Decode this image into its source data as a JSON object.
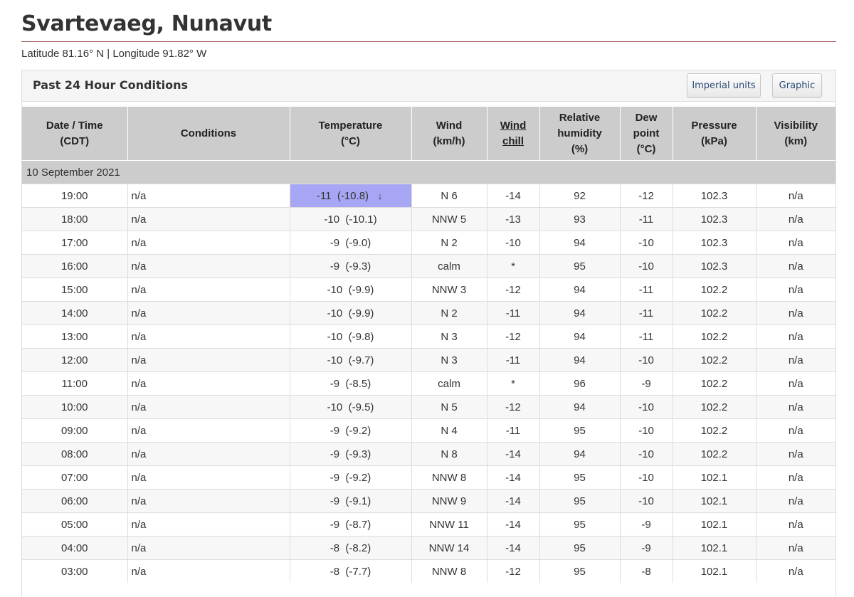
{
  "header": {
    "title": "Svartevaeg, Nunavut",
    "coordinates": "Latitude 81.16° N | Longitude 91.82° W"
  },
  "panel": {
    "title": "Past 24 Hour Conditions",
    "imperial_button": "Imperial units",
    "graphic_button": "Graphic"
  },
  "columns": {
    "datetime": [
      "Date / Time",
      "(CDT)"
    ],
    "conditions": "Conditions",
    "temperature": [
      "Temperature",
      "(°C)"
    ],
    "wind": [
      "Wind",
      "(km/h)"
    ],
    "wind_chill": [
      "Wind",
      "chill"
    ],
    "humidity": [
      "Relative",
      "humidity",
      "(%)"
    ],
    "dew_point": [
      "Dew",
      "point",
      "(°C)"
    ],
    "pressure": [
      "Pressure",
      "(kPa)"
    ],
    "visibility": [
      "Visibility",
      "(km)"
    ]
  },
  "date_group": "10 September 2021",
  "rows": [
    {
      "time": "19:00",
      "conditions": "n/a",
      "temp": "-11  (-10.8)",
      "wind": "N 6",
      "wind_chill": "-14",
      "humidity": "92",
      "dew_point": "-12",
      "pressure": "102.3",
      "visibility": "n/a",
      "temp_trend": "down-arrow-icon"
    },
    {
      "time": "18:00",
      "conditions": "n/a",
      "temp": "-10  (-10.1)",
      "wind": "NNW 5",
      "wind_chill": "-13",
      "humidity": "93",
      "dew_point": "-11",
      "pressure": "102.3",
      "visibility": "n/a"
    },
    {
      "time": "17:00",
      "conditions": "n/a",
      "temp": "-9  (-9.0)",
      "wind": "N 2",
      "wind_chill": "-10",
      "humidity": "94",
      "dew_point": "-10",
      "pressure": "102.3",
      "visibility": "n/a"
    },
    {
      "time": "16:00",
      "conditions": "n/a",
      "temp": "-9  (-9.3)",
      "wind": "calm",
      "wind_chill": "*",
      "humidity": "95",
      "dew_point": "-10",
      "pressure": "102.3",
      "visibility": "n/a"
    },
    {
      "time": "15:00",
      "conditions": "n/a",
      "temp": "-10  (-9.9)",
      "wind": "NNW 3",
      "wind_chill": "-12",
      "humidity": "94",
      "dew_point": "-11",
      "pressure": "102.2",
      "visibility": "n/a"
    },
    {
      "time": "14:00",
      "conditions": "n/a",
      "temp": "-10  (-9.9)",
      "wind": "N 2",
      "wind_chill": "-11",
      "humidity": "94",
      "dew_point": "-11",
      "pressure": "102.2",
      "visibility": "n/a"
    },
    {
      "time": "13:00",
      "conditions": "n/a",
      "temp": "-10  (-9.8)",
      "wind": "N 3",
      "wind_chill": "-12",
      "humidity": "94",
      "dew_point": "-11",
      "pressure": "102.2",
      "visibility": "n/a"
    },
    {
      "time": "12:00",
      "conditions": "n/a",
      "temp": "-10  (-9.7)",
      "wind": "N 3",
      "wind_chill": "-11",
      "humidity": "94",
      "dew_point": "-10",
      "pressure": "102.2",
      "visibility": "n/a"
    },
    {
      "time": "11:00",
      "conditions": "n/a",
      "temp": "-9  (-8.5)",
      "wind": "calm",
      "wind_chill": "*",
      "humidity": "96",
      "dew_point": "-9",
      "pressure": "102.2",
      "visibility": "n/a"
    },
    {
      "time": "10:00",
      "conditions": "n/a",
      "temp": "-10  (-9.5)",
      "wind": "N 5",
      "wind_chill": "-12",
      "humidity": "94",
      "dew_point": "-10",
      "pressure": "102.2",
      "visibility": "n/a"
    },
    {
      "time": "09:00",
      "conditions": "n/a",
      "temp": "-9  (-9.2)",
      "wind": "N 4",
      "wind_chill": "-11",
      "humidity": "95",
      "dew_point": "-10",
      "pressure": "102.2",
      "visibility": "n/a"
    },
    {
      "time": "08:00",
      "conditions": "n/a",
      "temp": "-9  (-9.3)",
      "wind": "N 8",
      "wind_chill": "-14",
      "humidity": "94",
      "dew_point": "-10",
      "pressure": "102.2",
      "visibility": "n/a"
    },
    {
      "time": "07:00",
      "conditions": "n/a",
      "temp": "-9  (-9.2)",
      "wind": "NNW 8",
      "wind_chill": "-14",
      "humidity": "95",
      "dew_point": "-10",
      "pressure": "102.1",
      "visibility": "n/a"
    },
    {
      "time": "06:00",
      "conditions": "n/a",
      "temp": "-9  (-9.1)",
      "wind": "NNW 9",
      "wind_chill": "-14",
      "humidity": "95",
      "dew_point": "-10",
      "pressure": "102.1",
      "visibility": "n/a"
    },
    {
      "time": "05:00",
      "conditions": "n/a",
      "temp": "-9  (-8.7)",
      "wind": "NNW 11",
      "wind_chill": "-14",
      "humidity": "95",
      "dew_point": "-9",
      "pressure": "102.1",
      "visibility": "n/a"
    },
    {
      "time": "04:00",
      "conditions": "n/a",
      "temp": "-8  (-8.2)",
      "wind": "NNW 14",
      "wind_chill": "-14",
      "humidity": "95",
      "dew_point": "-9",
      "pressure": "102.1",
      "visibility": "n/a"
    },
    {
      "time": "03:00",
      "conditions": "n/a",
      "temp": "-8  (-7.7)",
      "wind": "NNW 8",
      "wind_chill": "-12",
      "humidity": "95",
      "dew_point": "-8",
      "pressure": "102.1",
      "visibility": "n/a"
    }
  ],
  "colors": {
    "highlight": "#a6a6f5",
    "header_bg": "#cccccc",
    "title_rule": "#a85a5a",
    "button_text": "#2b4b74"
  }
}
